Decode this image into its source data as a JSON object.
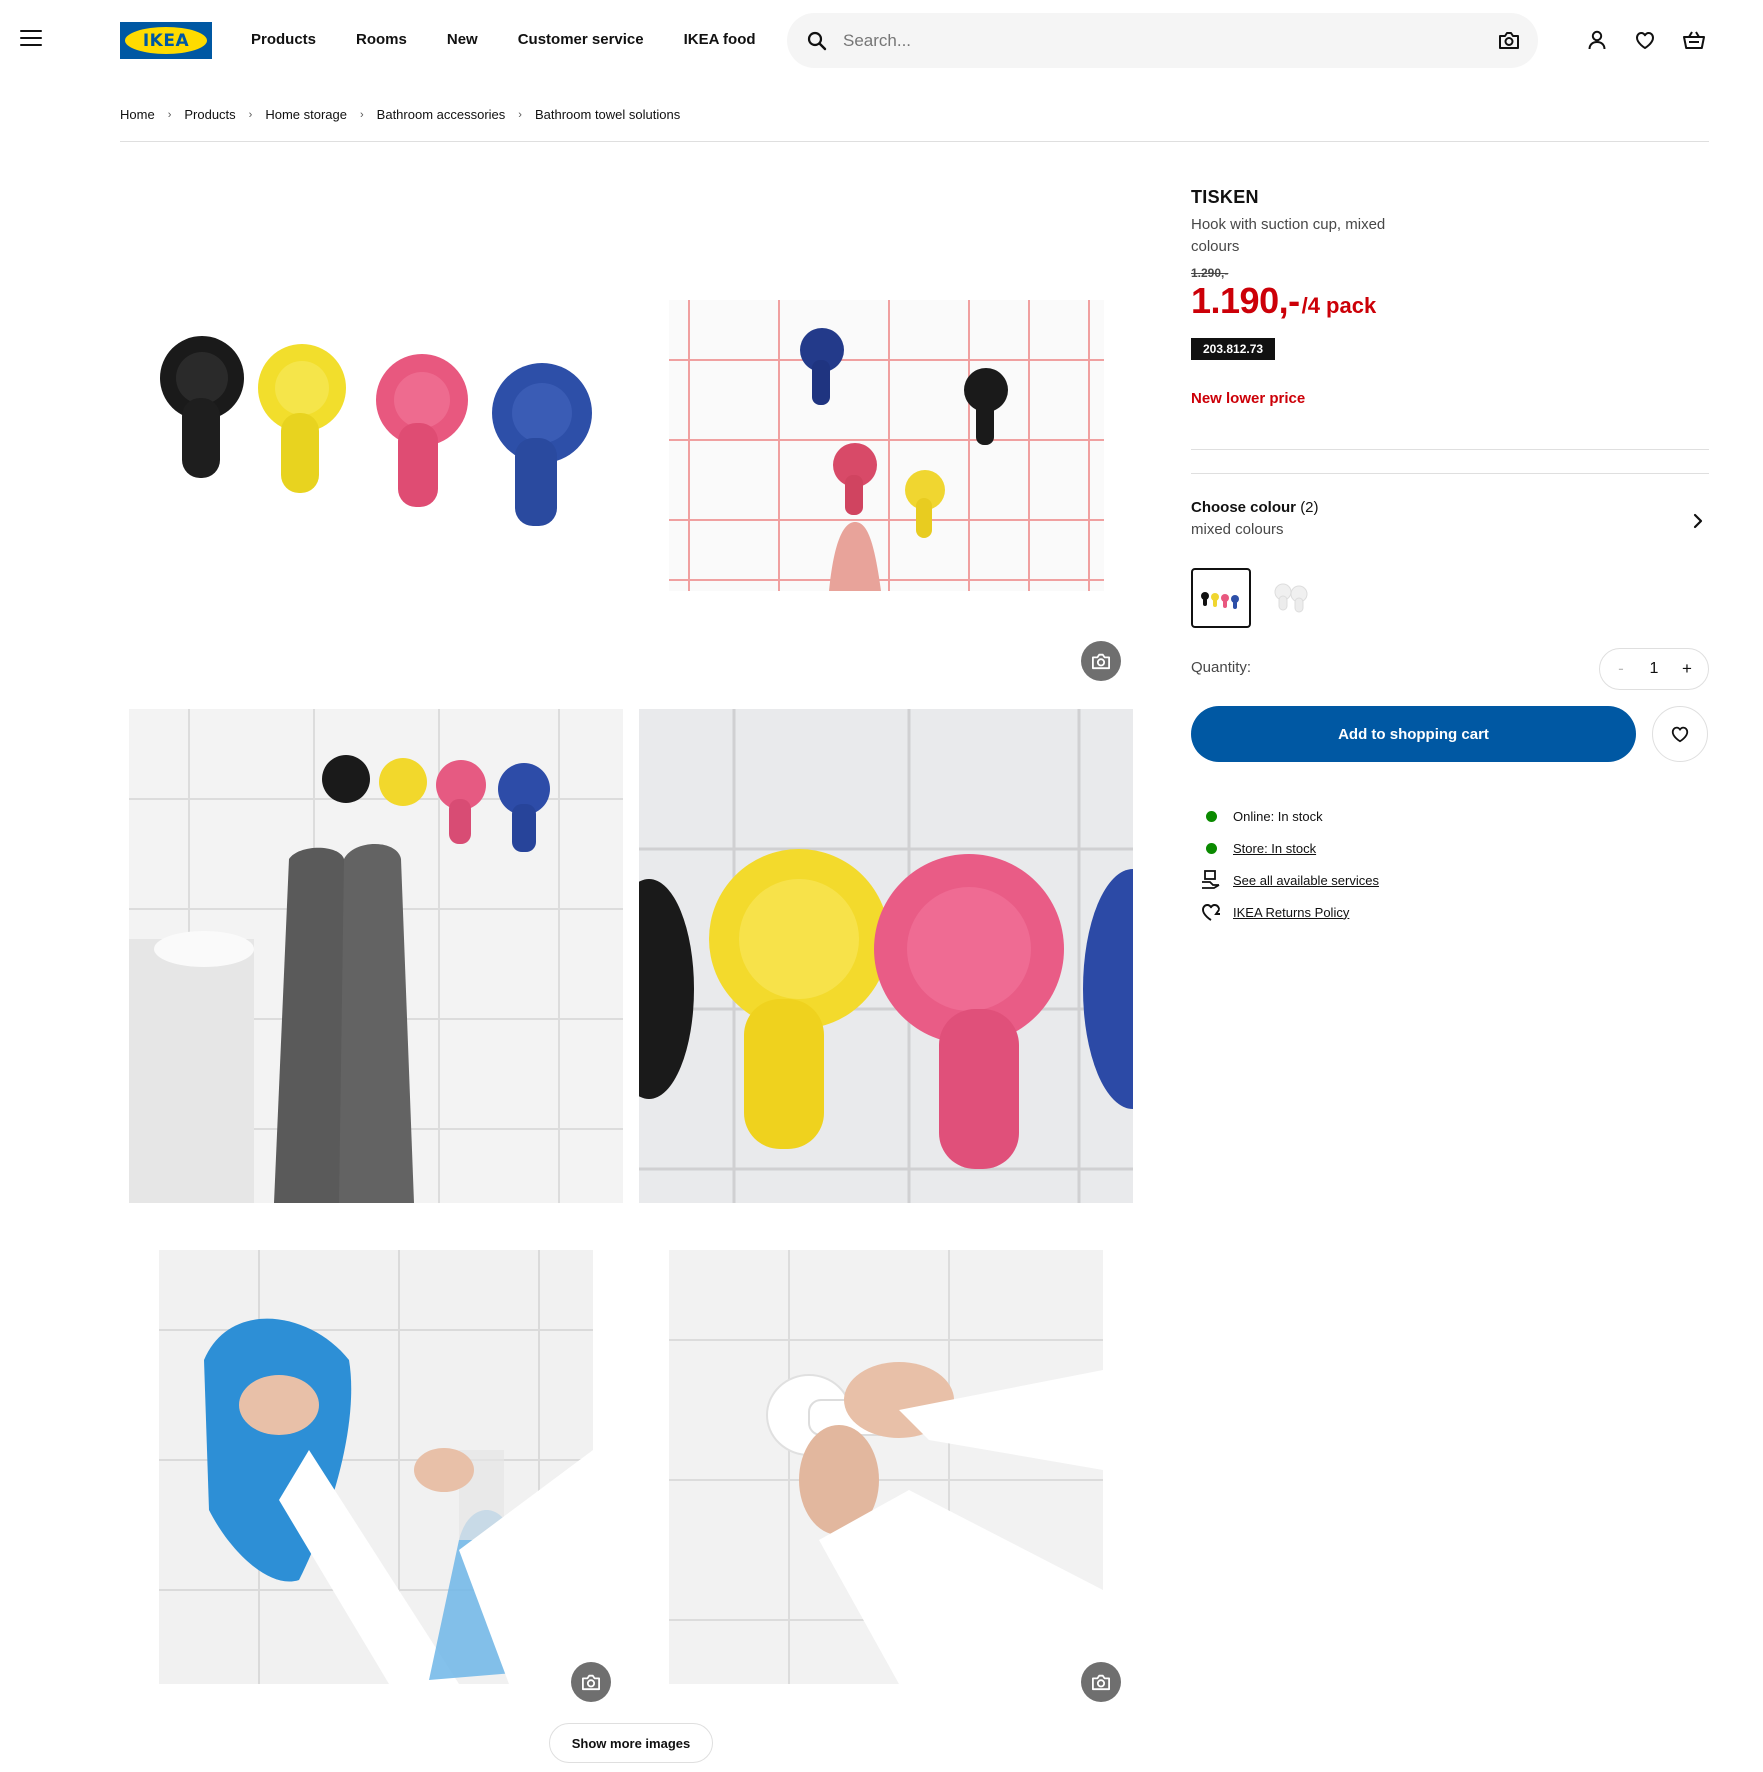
{
  "header": {
    "logo_text": "IKEA",
    "nav": [
      "Products",
      "Rooms",
      "New",
      "Customer service",
      "IKEA food"
    ],
    "search_placeholder": "Search...",
    "icons": [
      "menu-icon",
      "search-icon",
      "camera-icon",
      "profile-icon",
      "heart-icon",
      "cart-icon"
    ]
  },
  "breadcrumb": [
    "Home",
    "Products",
    "Home storage",
    "Bathroom accessories",
    "Bathroom towel solutions"
  ],
  "gallery": {
    "show_more_label": "Show more images"
  },
  "product": {
    "name": "TISKEN",
    "description": "Hook with suction cup, mixed colours",
    "old_price": "1.290,-",
    "price": "1.190,-",
    "price_unit": "/4 pack",
    "article_number": "203.812.73",
    "price_note": "New lower price",
    "colour_label": "Choose colour",
    "colour_count": "(2)",
    "colour_value": "mixed colours",
    "quantity_label": "Quantity:",
    "quantity_value": "1",
    "quantity_minus": "-",
    "quantity_plus": "+",
    "add_to_cart_label": "Add to shopping cart",
    "stock": {
      "online": "Online: In stock",
      "store": "Store: In stock",
      "services": "See all available services",
      "returns": "IKEA Returns Policy"
    }
  },
  "colors": {
    "brand_blue": "#0058a3",
    "brand_yellow": "#ffdb00",
    "price_red": "#cc0008",
    "in_stock_green": "#0a8a00"
  }
}
